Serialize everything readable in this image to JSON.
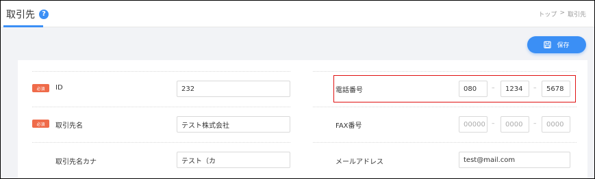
{
  "header": {
    "title": "取引先",
    "help_icon": "?",
    "breadcrumb": [
      "トップ",
      ">",
      "取引先"
    ]
  },
  "toolbar": {
    "save_label": "保存",
    "save_icon": "floppy-disk-icon"
  },
  "form": {
    "required_badge": "必須",
    "left": {
      "id": {
        "label": "ID",
        "value": "232",
        "required": true
      },
      "name": {
        "label": "取引先名",
        "value": "テスト株式会社",
        "required": true
      },
      "kana": {
        "label": "取引先名カナ",
        "value": "テスト（カ",
        "required": false
      }
    },
    "right": {
      "phone": {
        "label": "電話番号",
        "parts": [
          "080",
          "1234",
          "5678"
        ],
        "separator": "–"
      },
      "fax": {
        "label": "FAX番号",
        "placeholders": [
          "00000",
          "0000",
          "0000"
        ],
        "separator": "–"
      },
      "email": {
        "label": "メールアドレス",
        "value": "test@mail.com"
      }
    }
  },
  "colors": {
    "accent": "#3b8ff5",
    "required": "#ef6b4a",
    "highlight": "#e01010"
  }
}
